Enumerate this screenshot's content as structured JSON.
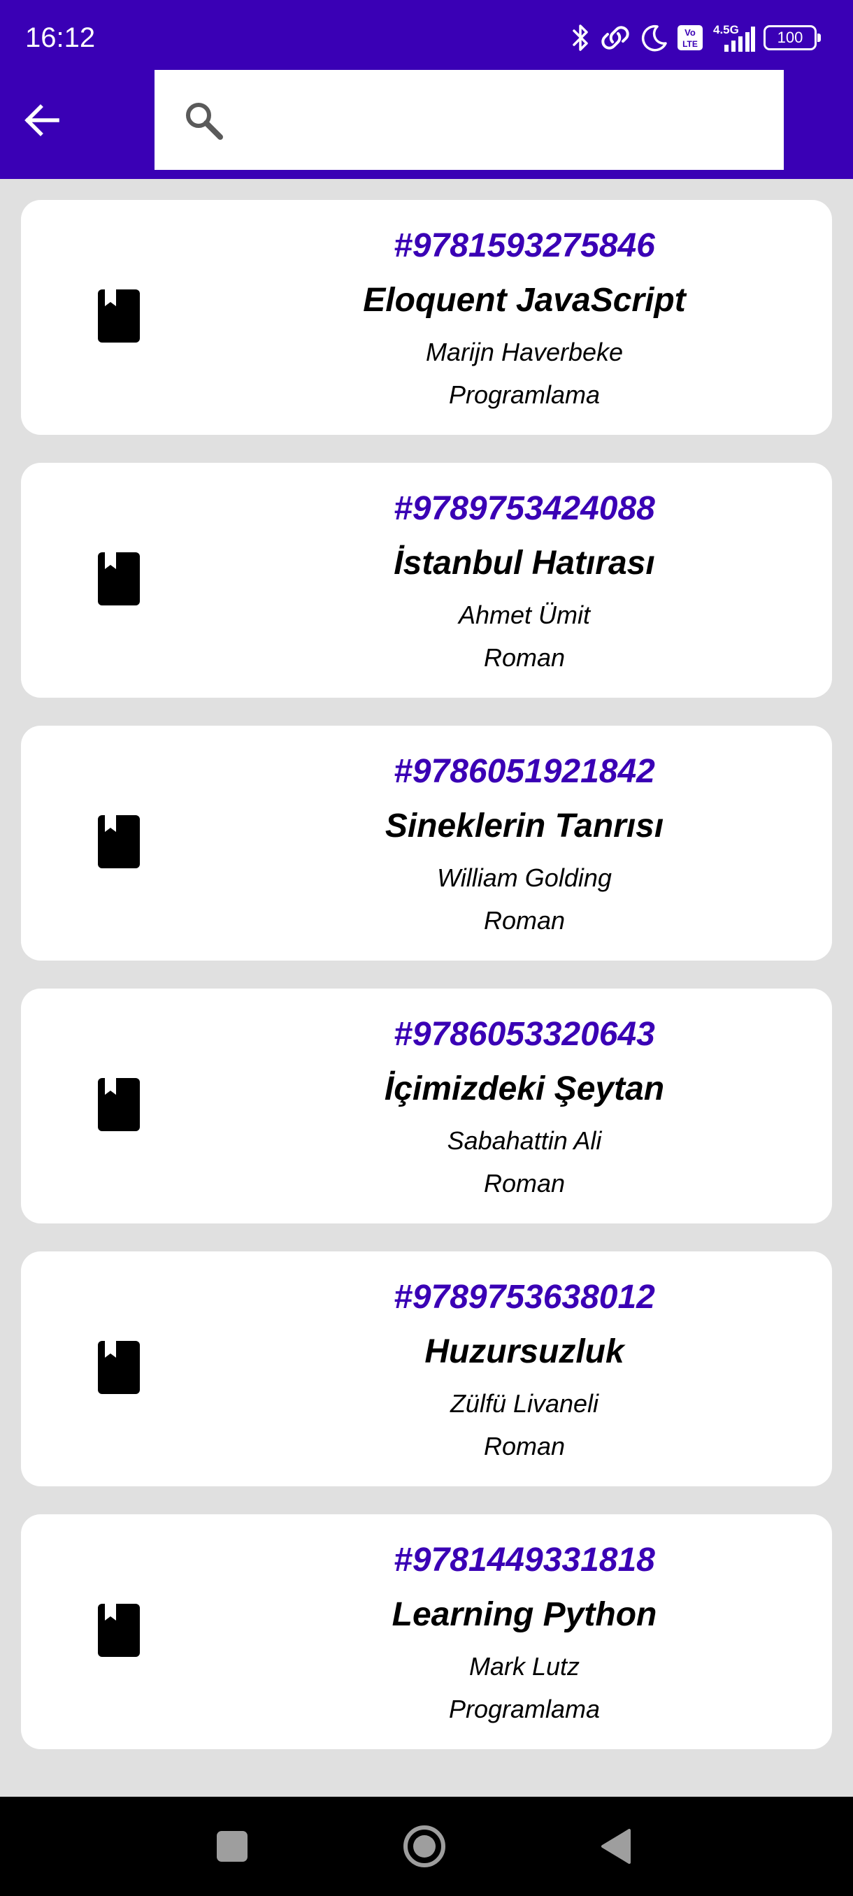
{
  "status_bar": {
    "time": "16:12",
    "icons": [
      "bluetooth-icon",
      "link-icon",
      "moon-icon",
      "volte-icon",
      "signal-4.5g-icon",
      "battery-icon"
    ],
    "network_label": "4.5G",
    "volte_label": "Vo LTE",
    "battery_level": "100"
  },
  "app_bar": {
    "background_color": "#3a00b5",
    "back_icon": "arrow-back-icon",
    "search": {
      "icon": "search-icon",
      "value": "",
      "placeholder": ""
    }
  },
  "books": [
    {
      "isbn": "#9781593275846",
      "title": "Eloquent JavaScript",
      "author": "Marijn Haverbeke",
      "category": "Programlama"
    },
    {
      "isbn": "#9789753424088",
      "title": "İstanbul Hatırası",
      "author": "Ahmet Ümit",
      "category": "Roman"
    },
    {
      "isbn": "#9786051921842",
      "title": "Sineklerin Tanrısı",
      "author": "William Golding",
      "category": "Roman"
    },
    {
      "isbn": "#9786053320643",
      "title": "İçimizdeki Şeytan",
      "author": "Sabahattin Ali",
      "category": "Roman"
    },
    {
      "isbn": "#9789753638012",
      "title": "Huzursuzluk",
      "author": "Zülfü Livaneli",
      "category": "Roman"
    },
    {
      "isbn": "#9781449331818",
      "title": "Learning Python",
      "author": "Mark Lutz",
      "category": "Programlama"
    }
  ],
  "colors": {
    "accent": "#3a00b5",
    "list_background": "#e0e0e0",
    "card_background": "#ffffff",
    "nav_bar": "#000000"
  },
  "nav_bar": {
    "icons": [
      "recents-square-icon",
      "home-circle-icon",
      "back-triangle-icon"
    ]
  }
}
